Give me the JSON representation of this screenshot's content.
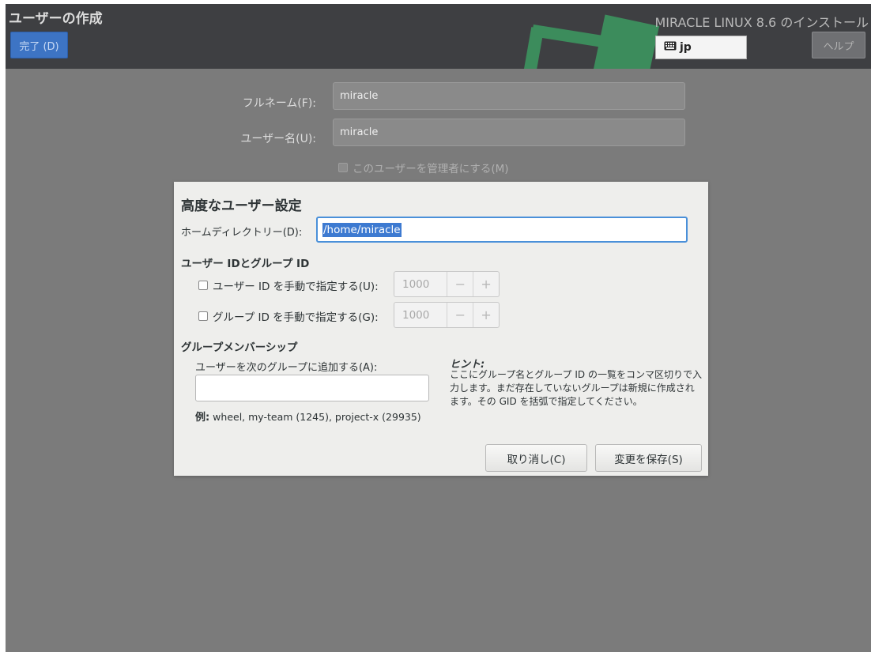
{
  "header": {
    "screen_title": "ユーザーの作成",
    "done_button": "完了 (D)",
    "product_title": "MIRACLE LINUX 8.6 のインストール",
    "keyboard_layout": "jp",
    "help_button": "ヘルプ"
  },
  "form": {
    "fullname_label": "フルネーム(F):",
    "fullname_value": "miracle",
    "username_label": "ユーザー名(U):",
    "username_value": "miracle",
    "admin_checkbox_label": "このユーザーを管理者にする(M)"
  },
  "dialog": {
    "title": "高度なユーザー設定",
    "home_label": "ホームディレクトリー(D):",
    "home_value": "/home/miracle",
    "id_section": "ユーザー IDとグループ ID",
    "uid_checkbox_label": "ユーザー ID を手動で指定する(U):",
    "uid_value": "1000",
    "gid_checkbox_label": "グループ ID を手動で指定する(G):",
    "gid_value": "1000",
    "spin_minus": "−",
    "spin_plus": "+",
    "membership_section": "グループメンバーシップ",
    "groups_label": "ユーザーを次のグループに追加する(A):",
    "groups_value": "",
    "example_prefix": "例:",
    "example_text": " wheel, my-team (1245), project-x (29935)",
    "hint_title": "ヒント:",
    "hint_text": "ここにグループ名とグループ ID の一覧をコンマ区切りで入力します。まだ存在していないグループは新規に作成されます。その GID を括弧で指定してください。",
    "cancel_button": "取り消し(C)",
    "save_button": "変更を保存(S)"
  },
  "colors": {
    "header_bg": "#3e3f42",
    "done_button_bg": "#3d74c4",
    "overlay_bg": "#7b7b7b",
    "dialog_bg": "#eeeeec",
    "accent_green": "#3c8c5c",
    "selection_blue": "#3d7ad1"
  },
  "icons": {
    "keyboard": "keyboard-icon"
  }
}
